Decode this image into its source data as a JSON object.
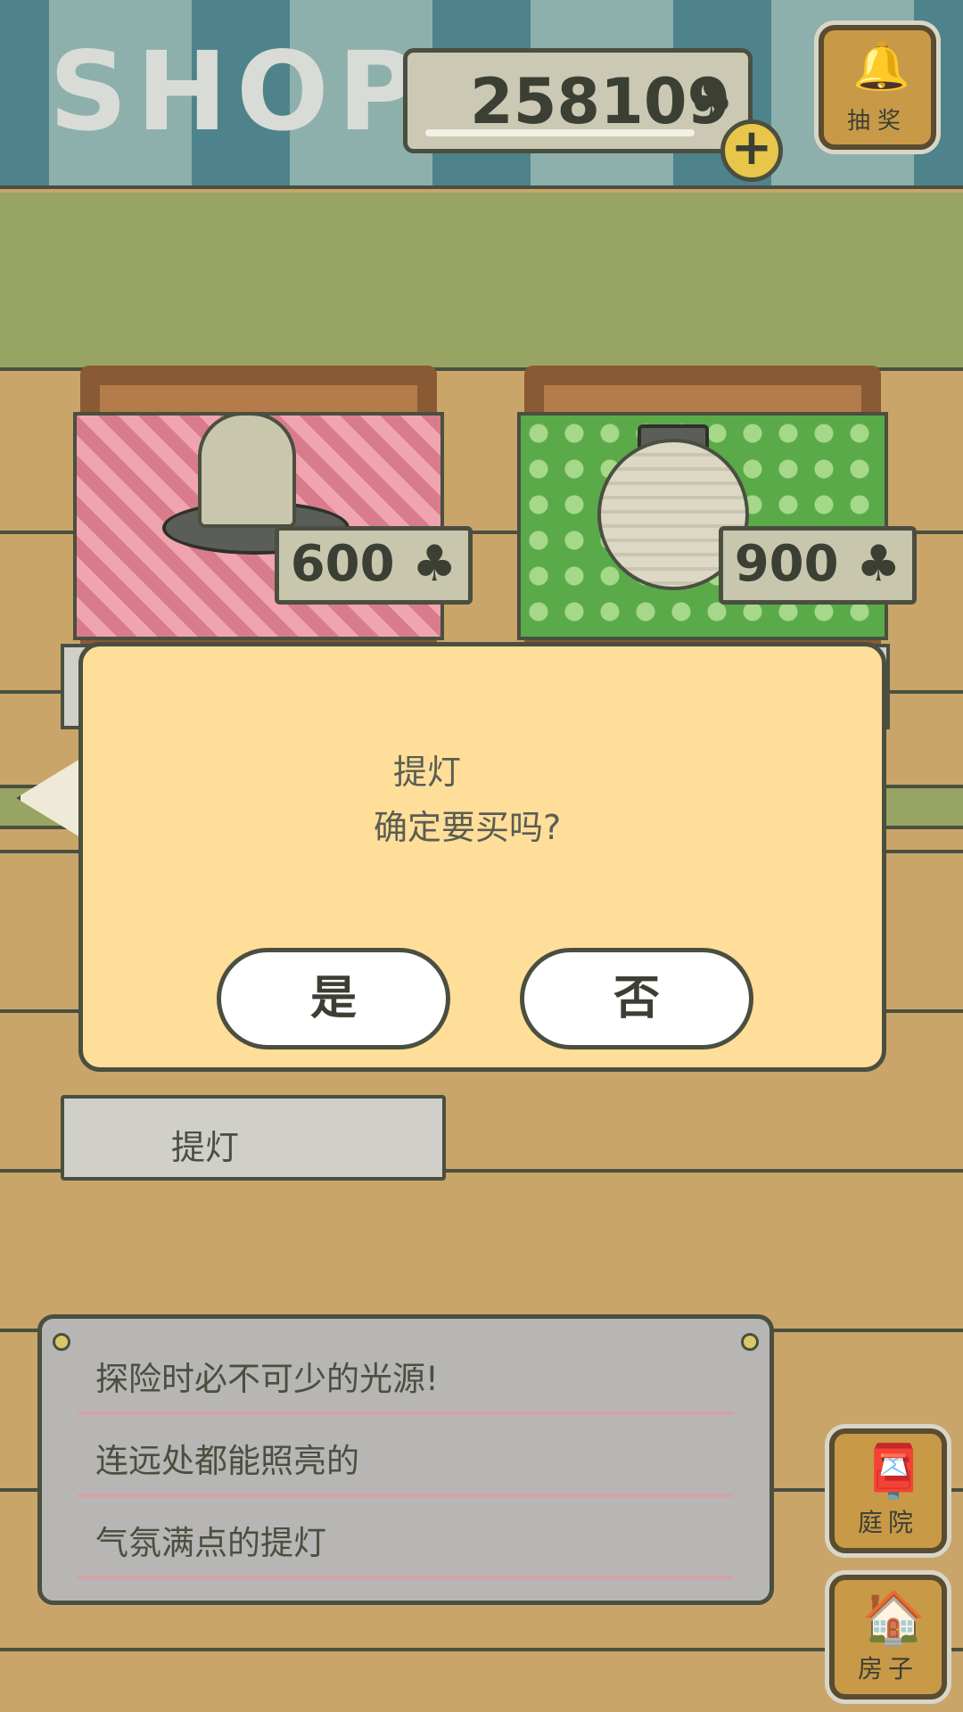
{
  "header": {
    "title": "SHOP",
    "coins": "258109",
    "coin_icon": "clover-icon",
    "add_coins_symbol": "+",
    "lottery_label": "抽奖"
  },
  "shop_items": [
    {
      "name": "candle",
      "price": "600",
      "price_icon": "clover-icon"
    },
    {
      "name": "lantern",
      "price": "900",
      "price_icon": "clover-icon"
    }
  ],
  "selected_item_label": "提灯",
  "dialog": {
    "item_name": "提灯",
    "question": "确定要买吗?",
    "yes_label": "是",
    "no_label": "否"
  },
  "description": {
    "lines": [
      "探险时必不可少的光源!",
      "连远处都能照亮的",
      "气氛满点的提灯"
    ]
  },
  "side_nav": {
    "garden_label": "庭院",
    "house_label": "房子"
  },
  "colors": {
    "dialog_bg": "#ffde9a",
    "outline": "#4a4f40",
    "wood": "#c9a56a",
    "grass": "#97a463"
  }
}
